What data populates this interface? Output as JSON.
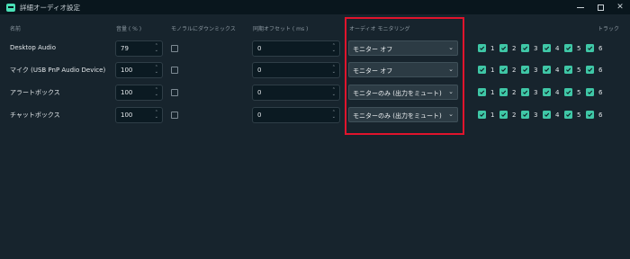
{
  "window": {
    "title": "詳細オーディオ設定",
    "controls": {
      "minimize": "—",
      "maximize": "□",
      "close": "✕"
    }
  },
  "headers": {
    "name": "名前",
    "volume": "音量 ( % )",
    "mono": "モノラルにダウンミックス",
    "sync": "同期オフセット ( ms )",
    "monitoring": "オーディオ モニタリング",
    "tracks": "トラック"
  },
  "spinner_arrows": "⌃\n⌄",
  "rows": [
    {
      "name": "Desktop Audio",
      "volume": "79",
      "mono": false,
      "sync_offset": "0",
      "monitoring": "モニター オフ",
      "tracks": [
        1,
        2,
        3,
        4,
        5,
        6
      ]
    },
    {
      "name": "マイク (USB PnP Audio Device)",
      "volume": "100",
      "mono": false,
      "sync_offset": "0",
      "monitoring": "モニター オフ",
      "tracks": [
        1,
        2,
        3,
        4,
        5,
        6
      ]
    },
    {
      "name": "アラートボックス",
      "volume": "100",
      "mono": false,
      "sync_offset": "0",
      "monitoring": "モニターのみ (出力をミュート)",
      "tracks": [
        1,
        2,
        3,
        4,
        5,
        6
      ]
    },
    {
      "name": "チャットボックス",
      "volume": "100",
      "mono": false,
      "sync_offset": "0",
      "monitoring": "モニターのみ (出力をミュート)",
      "tracks": [
        1,
        2,
        3,
        4,
        5,
        6
      ]
    }
  ],
  "track_labels": [
    "1",
    "2",
    "3",
    "4",
    "5",
    "6"
  ],
  "colors": {
    "accent": "#3fc7a6",
    "highlight": "#e0142c",
    "background": "#17242d"
  },
  "icons": {
    "dropdown": "chevron-down-icon",
    "check": "check-icon"
  }
}
